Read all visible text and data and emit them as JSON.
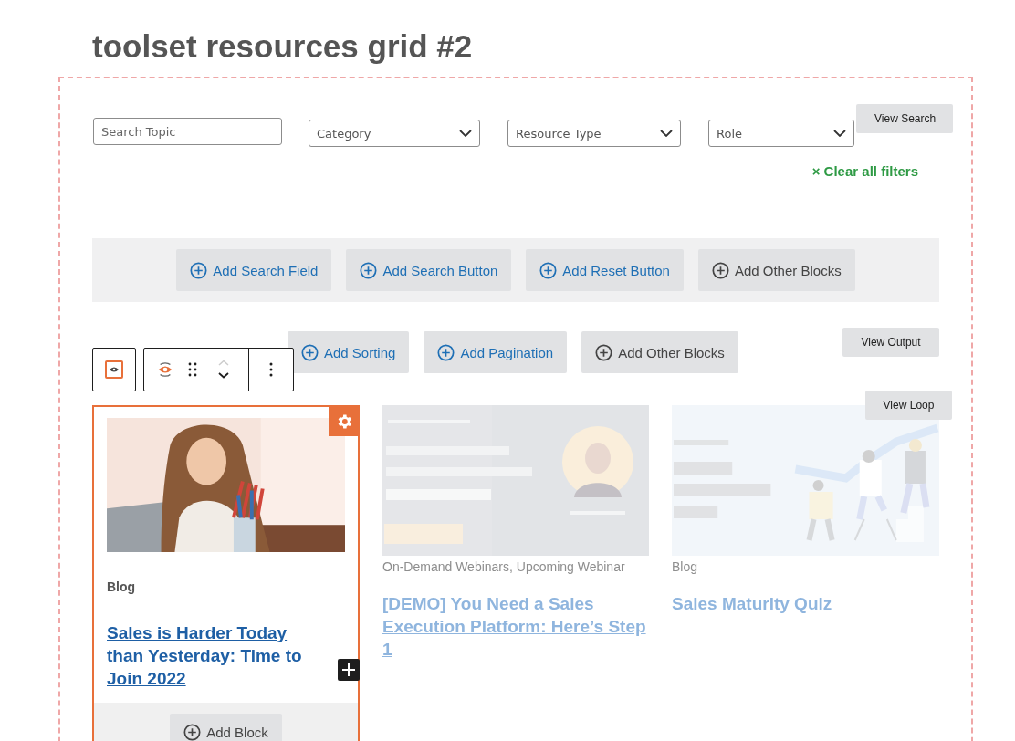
{
  "page_title": "toolset resources grid #2",
  "search_form": {
    "fields": [
      {
        "kind": "text",
        "placeholder": "Search Topic"
      },
      {
        "kind": "select",
        "value": "Category"
      },
      {
        "kind": "select",
        "value": "Resource Type"
      },
      {
        "kind": "select",
        "value": "Role"
      }
    ],
    "view_button": "View Search",
    "clear_link": "× Clear all filters"
  },
  "search_block_buttons": [
    {
      "label": "Add Search Field",
      "kind": "primary"
    },
    {
      "label": "Add Search Button",
      "kind": "primary"
    },
    {
      "label": "Add Reset Button",
      "kind": "primary"
    },
    {
      "label": "Add Other Blocks",
      "kind": "secondary"
    }
  ],
  "output_block_buttons": [
    {
      "label": "Add Sorting",
      "kind": "primary"
    },
    {
      "label": "Add Pagination",
      "kind": "primary"
    },
    {
      "label": "Add Other Blocks",
      "kind": "secondary"
    }
  ],
  "view_output_button": "View Output",
  "view_loop_button": "View Loop",
  "posts": [
    {
      "kind": "picture",
      "category": "Blog",
      "title": "Sales is Harder Today than Yesterday: Time to Join 2022",
      "selected": true
    },
    {
      "kind": "picture",
      "category": "On-Demand Webinars, Upcoming Webinar",
      "title": "[DEMO] You Need a Sales Execution Platform: Here’s Step 1",
      "selected": false
    },
    {
      "kind": "picture",
      "category": "Blog",
      "title": "Sales Maturity Quiz",
      "selected": false
    }
  ],
  "add_block_button": "Add Block"
}
